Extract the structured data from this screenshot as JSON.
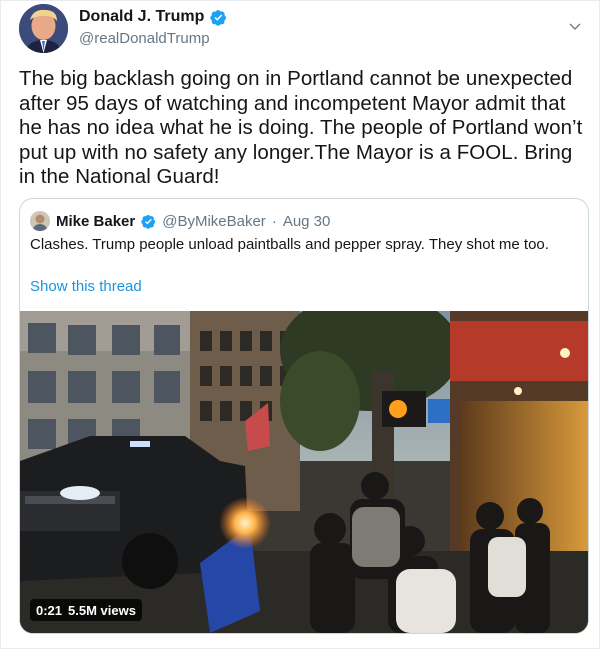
{
  "author": {
    "display_name": "Donald J. Trump",
    "handle": "@realDonaldTrump",
    "verified": true,
    "avatar_icon": "user-avatar-photo"
  },
  "tweet": {
    "text": "The big backlash going on in Portland cannot be unexpected after 95 days of watching and incompetent Mayor admit that he has no idea what he is doing. The people of Portland won’t put up with no safety any longer.The Mayor is a FOOL. Bring in the National Guard!"
  },
  "menu_icon": "chevron-down-icon",
  "quoted_tweet": {
    "display_name": "Mike Baker",
    "handle": "@ByMikeBaker",
    "separator": "·",
    "date": "Aug 30",
    "verified": true,
    "text": "Clashes. Trump people unload paintballs and pepper spray. They shot me too.",
    "show_thread_label": "Show this thread",
    "video": {
      "duration": "0:21",
      "views": "5.5M views"
    }
  },
  "colors": {
    "verified_blue": "#1da1f2",
    "link_blue": "#1b95e0",
    "secondary_text": "#657786",
    "border": "#ccd6dd"
  }
}
